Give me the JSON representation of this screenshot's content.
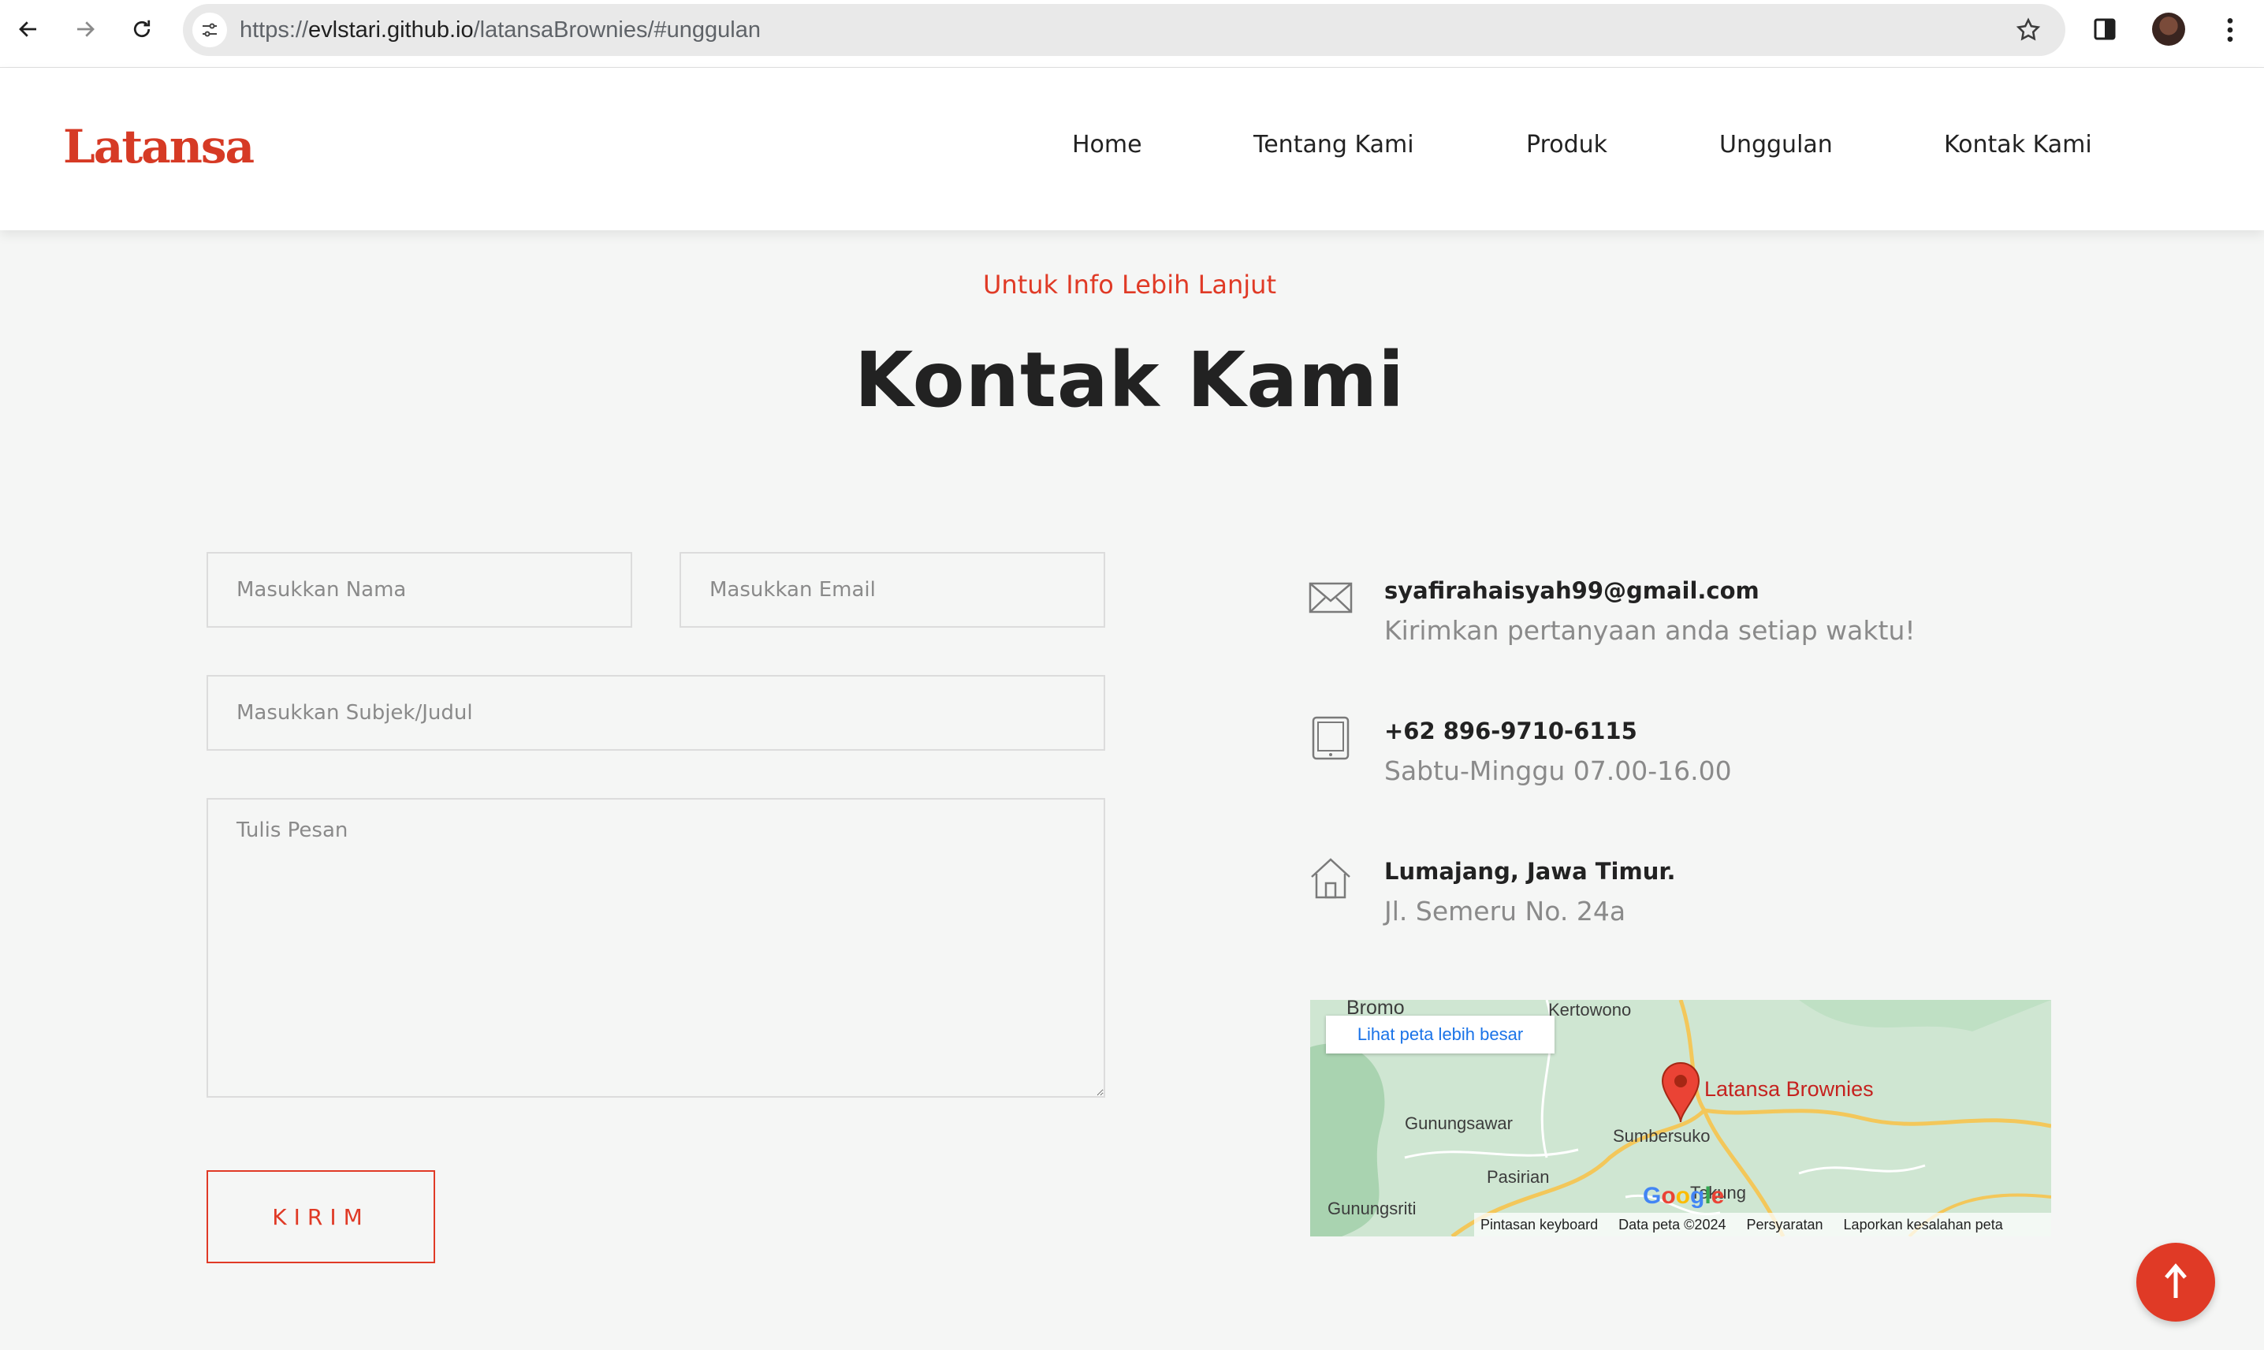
{
  "browser": {
    "url_prefix": "https://",
    "url_host": "evlstari.github.io",
    "url_path": "/latansaBrownies/#unggulan"
  },
  "site": {
    "logo_text": "Latansa",
    "nav": [
      "Home",
      "Tentang Kami",
      "Produk",
      "Unggulan",
      "Kontak Kami"
    ]
  },
  "section": {
    "eyebrow": "Untuk Info Lebih Lanjut",
    "title": "Kontak Kami"
  },
  "form": {
    "name_placeholder": "Masukkan Nama",
    "email_placeholder": "Masukkan Email",
    "subject_placeholder": "Masukkan Subjek/Judul",
    "message_placeholder": "Tulis Pesan",
    "submit_label": "KIRIM"
  },
  "contact": {
    "email": "syafirahaisyah99@gmail.com",
    "email_note": "Kirimkan pertanyaan anda setiap waktu!",
    "phone": "+62 896-9710-6115",
    "phone_note": "Sabtu-Minggu 07.00-16.00",
    "city": "Lumajang, Jawa Timur.",
    "address": "Jl. Semeru No. 24a"
  },
  "map": {
    "view_larger": "Lihat peta lebih besar",
    "place_name": "Latansa Brownies",
    "places": [
      "Bromo",
      "Kertowono",
      "Gunungsawar",
      "Sumbersuko",
      "Pasirian",
      "Tekung",
      "Gunungsriti"
    ],
    "google": "Google",
    "footer": [
      "Pintasan keyboard",
      "Data peta ©2024",
      "Persyaratan",
      "Laporkan kesalahan peta"
    ]
  },
  "icons": [
    "back-arrow-icon",
    "forward-arrow-icon",
    "reload-icon",
    "site-settings-icon",
    "star-icon",
    "side-panel-icon",
    "kebab-menu-icon",
    "envelope-icon",
    "tablet-icon",
    "house-icon",
    "map-pin-icon",
    "arrow-up-icon"
  ],
  "colors": {
    "accent": "#e03a26",
    "background": "#f5f6f5"
  }
}
